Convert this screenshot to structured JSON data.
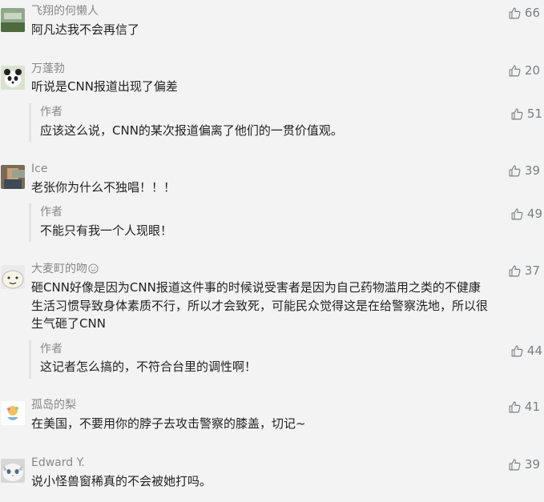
{
  "icons": {
    "like": "thumbs-up-icon",
    "emoji": "smiley-emoji-icon"
  },
  "colors": {
    "background": "#f3f3f3",
    "nickname": "#888888",
    "text": "#222222",
    "like": "#7b7f83",
    "reply_border": "#e3e3e3"
  },
  "comments": [
    {
      "nickname": "飞翔的何懒人",
      "text": "阿凡达我不会再信了",
      "likes": "66"
    },
    {
      "nickname": "万蓬勃",
      "text": "听说是CNN报道出现了偏差",
      "likes": "20",
      "reply": {
        "author_label": "作者",
        "text": "应该这么说，CNN的某次报道偏离了他们的一贯价值观。",
        "likes": "51"
      }
    },
    {
      "nickname": "Ice",
      "text": "老张你为什么不独唱！！！",
      "likes": "39",
      "reply": {
        "author_label": "作者",
        "text": "不能只有我一个人现眼！",
        "likes": "49"
      }
    },
    {
      "nickname": "大麦町的吻",
      "text_lines": [
        "砸CNN好像是因为CNN报道这件事的时候说受害者是因为自己药物滥用之类的不健康",
        "生活习惯导致身体素质不行，所以才会致死，可能民众觉得这是在给警察洗地，所以很",
        "生气砸了CNN"
      ],
      "likes": "37",
      "reply": {
        "author_label": "作者",
        "text": "这记者怎么搞的，不符合台里的调性啊！",
        "likes": "44"
      }
    },
    {
      "nickname": "孤岛的梨",
      "text": "在美国，不要用你的脖子去攻击警察的膝盖，切记~",
      "likes": "41"
    },
    {
      "nickname": "Edward Y.",
      "text": "说小怪兽窗稀真的不会被她打吗。",
      "likes": "39"
    }
  ]
}
